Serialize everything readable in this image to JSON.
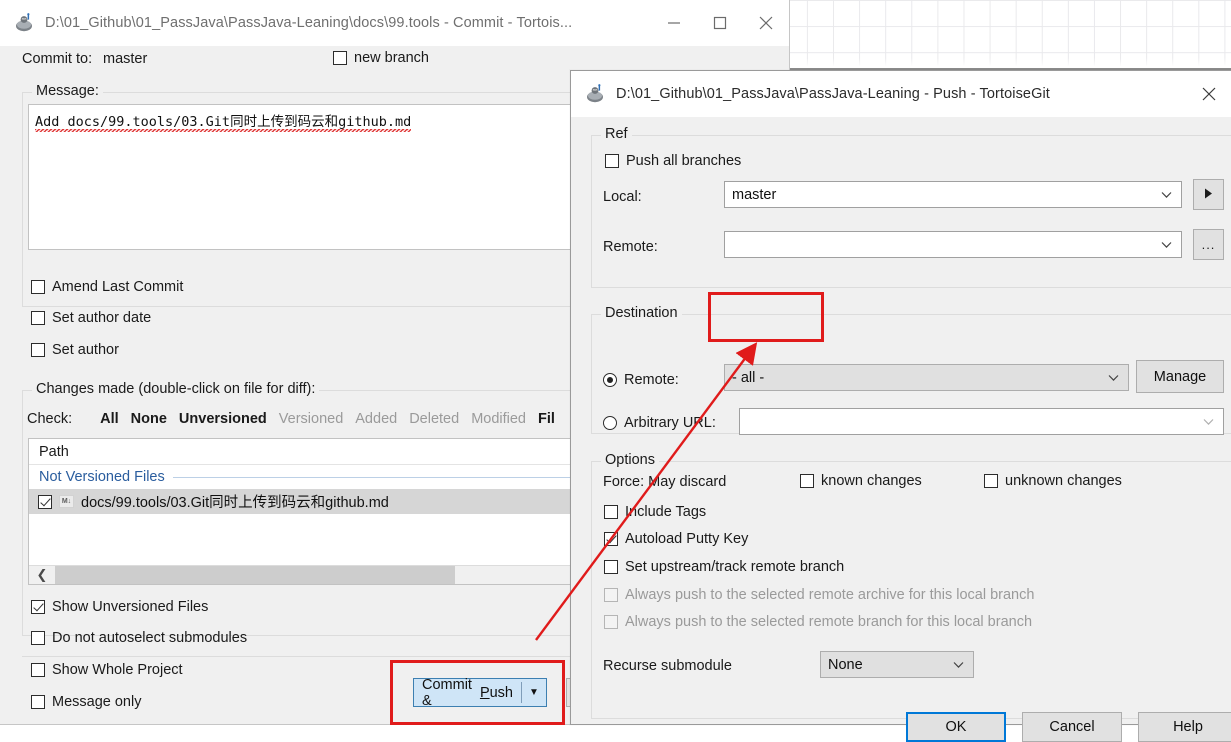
{
  "backdrop": {
    "note": "light grid pattern desktop background"
  },
  "commit_window": {
    "title": "D:\\01_Github\\01_PassJava\\PassJava-Leaning\\docs\\99.tools - Commit - Tortois...",
    "icon": "tortoisegit-icon",
    "titlebar_buttons": {
      "minimize": "minimize-icon",
      "maximize": "maximize-icon",
      "close": "close-icon"
    },
    "commit_to_label": "Commit to:",
    "commit_to_value": "master",
    "new_branch_label": "new branch",
    "new_branch_checked": false,
    "message_group": "Message:",
    "message_text": "Add docs/99.tools/03.Git同时上传到码云和github.md",
    "options": [
      {
        "label": "Amend Last Commit",
        "checked": false
      },
      {
        "label": "Set author date",
        "checked": false
      },
      {
        "label": "Set author",
        "checked": false
      }
    ],
    "changes_group": "Changes made (double-click on file for diff):",
    "check_label": "Check:",
    "check_links": [
      {
        "label": "All",
        "enabled": true
      },
      {
        "label": "None",
        "enabled": true
      },
      {
        "label": "Unversioned",
        "enabled": true
      },
      {
        "label": "Versioned",
        "enabled": false
      },
      {
        "label": "Added",
        "enabled": false
      },
      {
        "label": "Deleted",
        "enabled": false
      },
      {
        "label": "Modified",
        "enabled": false
      },
      {
        "label": "Fil",
        "enabled": true
      }
    ],
    "list_header": "Path",
    "list_group": "Not Versioned Files",
    "list_rows": [
      {
        "checked": true,
        "icon": "markdown-file-icon",
        "path": "docs/99.tools/03.Git同时上传到码云和github.md"
      }
    ],
    "bottom_options": [
      {
        "label": "Show Unversioned Files",
        "checked": true
      },
      {
        "label": "Do not autoselect submodules",
        "checked": false
      },
      {
        "label": "Show Whole Project",
        "checked": false
      },
      {
        "label": "Message only",
        "checked": false
      }
    ],
    "commit_push_button": {
      "label_pre": "Commit & ",
      "label_acc": "P",
      "label_post": "ush",
      "dropdown": "chevron-down-icon"
    }
  },
  "push_window": {
    "title": "D:\\01_Github\\01_PassJava\\PassJava-Leaning - Push - TortoiseGit",
    "icon": "tortoisegit-icon",
    "close_button": "close-icon",
    "ref_group": "Ref",
    "push_all_branches": {
      "label": "Push all branches",
      "checked": false
    },
    "local_label": "Local:",
    "local_value": "master",
    "local_browse_button": "play-arrow-icon",
    "remote_label": "Remote:",
    "remote_value": "",
    "remote_browse_button": "...",
    "destination_group": "Destination",
    "dest_remote": {
      "label": "Remote:",
      "selected": true,
      "value": "- all -"
    },
    "manage_button": "Manage",
    "dest_arbitrary": {
      "label": "Arbitrary URL:",
      "selected": false,
      "value": ""
    },
    "options_group": "Options",
    "force_label": "Force: May discard",
    "force_known": {
      "label": "known changes",
      "checked": false
    },
    "force_unknown": {
      "label": "unknown changes",
      "checked": false
    },
    "option_rows": [
      {
        "label": "Include Tags",
        "checked": false,
        "enabled": true
      },
      {
        "label": "Autoload Putty Key",
        "checked": true,
        "enabled": true
      },
      {
        "label": "Set upstream/track remote branch",
        "checked": false,
        "enabled": true
      },
      {
        "label": "Always push to the selected remote archive for this local branch",
        "checked": false,
        "enabled": false
      },
      {
        "label": "Always push to the selected remote branch for this local branch",
        "checked": false,
        "enabled": false
      }
    ],
    "recurse_label": "Recurse submodule",
    "recurse_value": "None",
    "buttons": [
      {
        "label": "OK",
        "default": true
      },
      {
        "label": "Cancel",
        "default": false
      },
      {
        "label": "Help",
        "default": false
      }
    ]
  },
  "annotations": {
    "color": "#e01b1b",
    "rect_all": "highlight around '- all -' remote combo",
    "rect_commit_push": "highlight around Commit & Push button",
    "arrow": "red arrow from Commit & Push button to the '- all -' combo"
  }
}
